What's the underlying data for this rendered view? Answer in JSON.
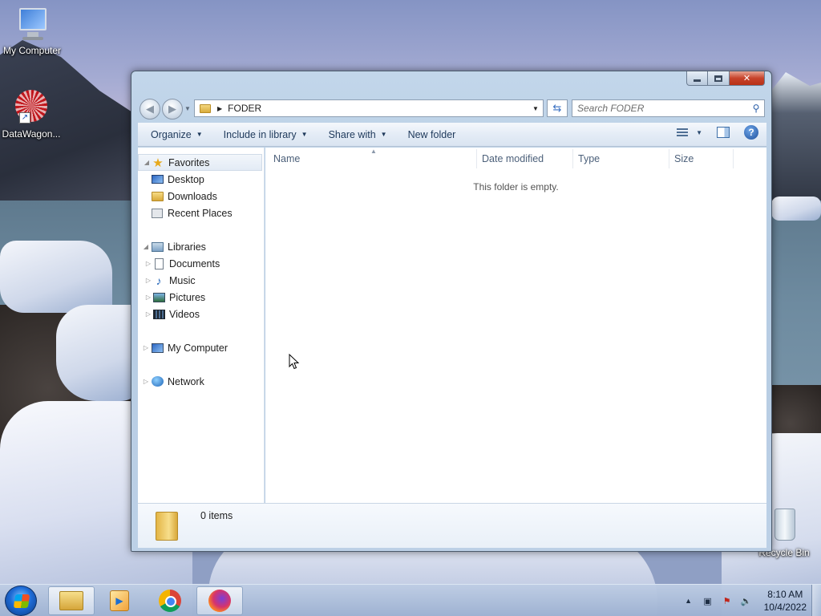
{
  "desktop": {
    "icons": [
      {
        "label": "My Computer",
        "icon": "computer-icon"
      },
      {
        "label": "DataWagon...",
        "icon": "datawagon-shortcut-icon"
      },
      {
        "label": "Recycle Bin",
        "icon": "recycle-bin-icon"
      }
    ]
  },
  "window": {
    "caption": {
      "minimize": "minimize",
      "maximize": "maximize",
      "close": "✕"
    },
    "address": {
      "path": "FODER"
    },
    "search": {
      "placeholder": "Search FODER"
    },
    "commands": {
      "organize": "Organize",
      "include_in_library": "Include in library",
      "share_with": "Share with",
      "new_folder": "New folder"
    },
    "nav": {
      "favorites": {
        "label": "Favorites",
        "items": [
          "Desktop",
          "Downloads",
          "Recent Places"
        ]
      },
      "libraries": {
        "label": "Libraries",
        "items": [
          "Documents",
          "Music",
          "Pictures",
          "Videos"
        ]
      },
      "computer": "My Computer",
      "network": "Network"
    },
    "columns": [
      "Name",
      "Date modified",
      "Type",
      "Size"
    ],
    "empty_message": "This folder is empty.",
    "details": {
      "count": "0 items"
    }
  },
  "taskbar": {
    "pinned": [
      "windows-explorer",
      "windows-media-player",
      "google-chrome",
      "firefox"
    ],
    "clock": {
      "time": "8:10 AM",
      "date": "10/4/2022"
    }
  },
  "colors": {
    "window_frame": "#bcd0e6",
    "command_text": "#1e395b",
    "close_button": "#c7432b"
  }
}
